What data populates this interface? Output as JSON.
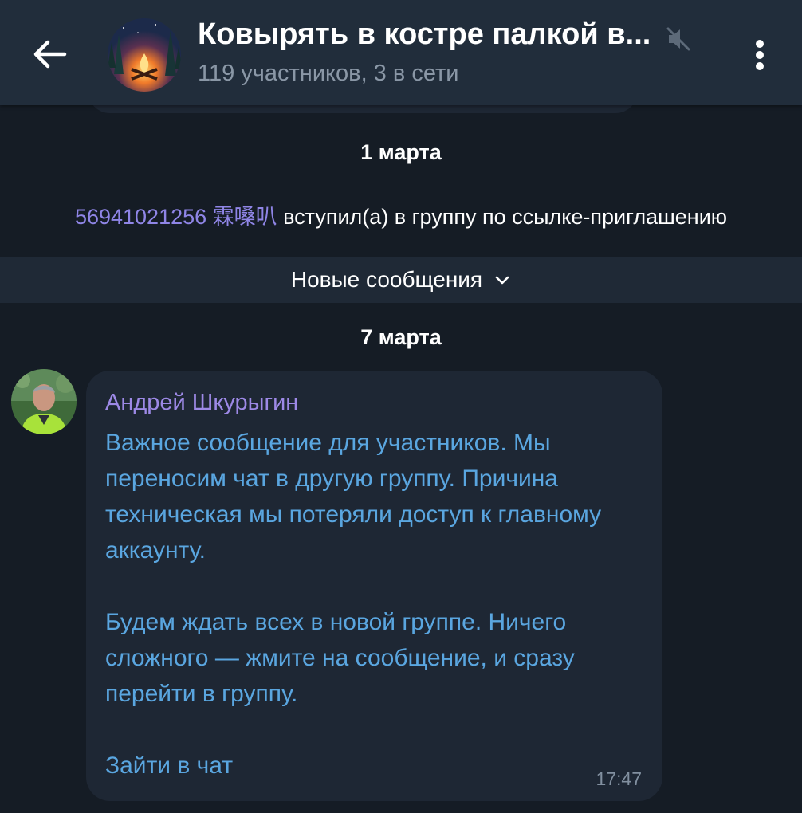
{
  "header": {
    "title": "Ковырять в костре палкой в...",
    "subtitle": "119 участников, 3 в сети",
    "back_icon": "arrow-left-icon",
    "mute_icon": "muted-speaker-icon",
    "menu_icon": "more-vertical-icon"
  },
  "dates": {
    "first": "1 марта",
    "second": "7 марта"
  },
  "service_message": {
    "user": "56941021256 霖嗓叭",
    "text": " вступил(а) в группу по ссылке-приглашению"
  },
  "new_messages_bar": {
    "label": "Новые сообщения"
  },
  "message": {
    "sender": "Андрей Шкурыгин",
    "paragraphs": [
      "Важное сообщение для участников. Мы переносим чат в другую группу. Причина техническая мы потеряли доступ к главному аккаунту.",
      "Будем ждать всех в новой группе. Ничего сложного — жмите на сообщение, и сразу перейти в группу.",
      "Зайти в чат"
    ],
    "time": "17:47"
  },
  "colors": {
    "background": "#151c25",
    "header": "#212d3b",
    "bubble": "#1e2734",
    "link_text": "#5aa6e0",
    "sender_name": "#9d89e6",
    "service_user": "#8f85e6"
  }
}
